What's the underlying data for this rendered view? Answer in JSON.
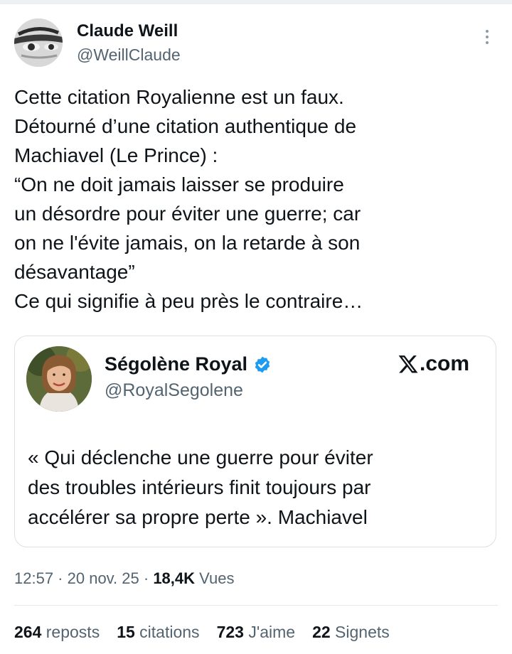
{
  "tweet": {
    "author_name": "Claude Weill",
    "author_handle": "@WeillClaude",
    "more_icon": "more-vertical-icon",
    "text_lines": [
      "Cette citation Royalienne est un faux.",
      "Détourné d’une citation authentique de",
      "Machiavel (Le Prince) :",
      "“On ne doit jamais laisser se produire",
      "un désordre pour éviter une guerre; car",
      "on ne l'évite jamais, on la retarde à son",
      "désavantage”",
      "Ce qui signifie à peu près le contraire…"
    ]
  },
  "quote": {
    "author_name": "Ségolène Royal",
    "author_handle": "@RoyalSegolene",
    "verified_icon": "verified-badge-icon",
    "site_label": ".com",
    "site_icon": "x-logo-icon",
    "text_lines": [
      "« Qui déclenche une guerre pour éviter",
      "des troubles intérieurs finit toujours par",
      "accélérer sa propre perte ». Machiavel"
    ]
  },
  "meta": {
    "time": "12:57",
    "sep1": " · ",
    "date": "20 nov. 25",
    "sep2": " · ",
    "views_count": "18,4K",
    "views_label": " Vues"
  },
  "stats": {
    "reposts_count": "264",
    "reposts_label": " reposts",
    "citations_count": "15",
    "citations_label": " citations",
    "likes_count": "723",
    "likes_label": " J'aime",
    "bookmarks_count": "22",
    "bookmarks_label": " Signets"
  },
  "colors": {
    "text_primary": "#0f1419",
    "text_secondary": "#536471",
    "verified_blue": "#1d9bf0",
    "border": "#dbe0e4"
  }
}
